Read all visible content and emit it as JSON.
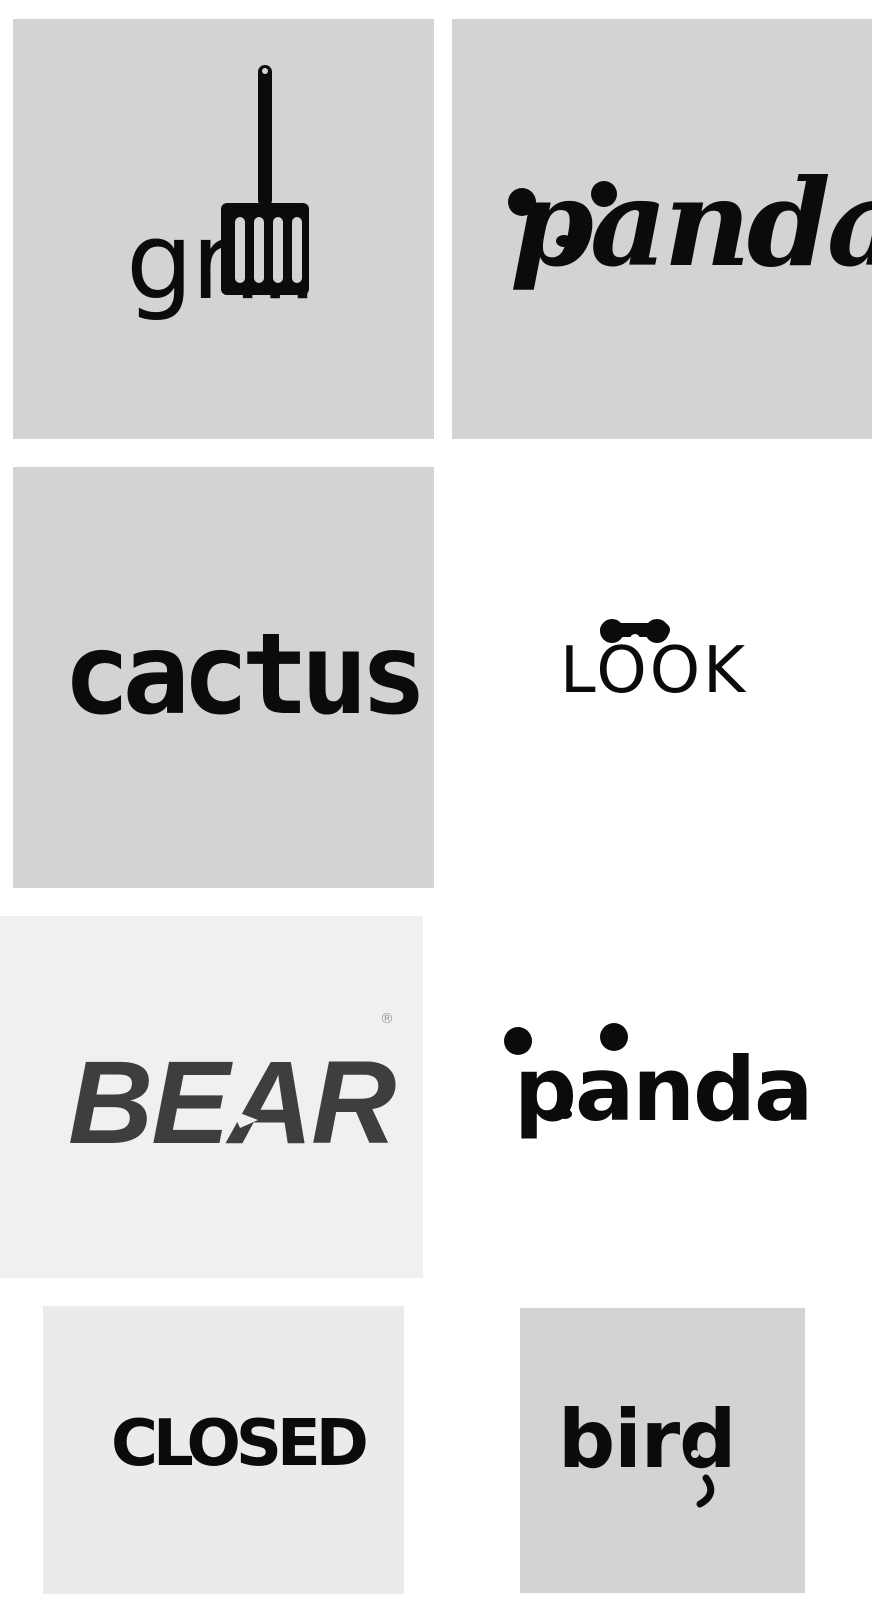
{
  "logos": [
    {
      "id": "grill",
      "word": "grill"
    },
    {
      "id": "panda1",
      "word": "panda"
    },
    {
      "id": "cactus",
      "word": "cactus"
    },
    {
      "id": "look",
      "word": "LOOK"
    },
    {
      "id": "bear",
      "word": "BEAR",
      "mark": "®"
    },
    {
      "id": "panda2",
      "word": "panda"
    },
    {
      "id": "closed",
      "word": "CLOSED"
    },
    {
      "id": "bird",
      "word": "bird"
    }
  ],
  "colors": {
    "tile_gray": "#d2d3d5",
    "tile_light": "#eff0ef",
    "tile_offwhite": "#ebebea",
    "ink": "#0b0b0b",
    "bear_ink": "#3e3e3e"
  },
  "icons": [
    "spatula-icon",
    "panda-ears-icon",
    "binoculars-icon",
    "bear-head-icon",
    "bird-head-icon"
  ]
}
